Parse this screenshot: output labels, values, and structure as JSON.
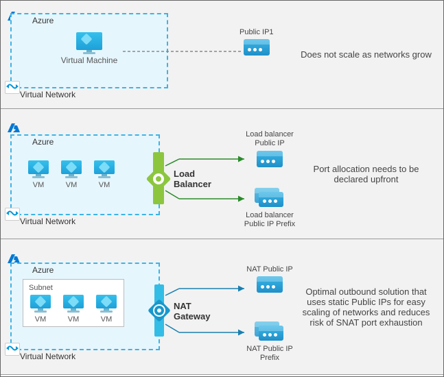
{
  "azure_label": "Azure",
  "vnet_label": "Virtual Network",
  "row1": {
    "vm_label": "Virtual Machine",
    "pip_label": "Public IP1",
    "desc": "Does not scale as networks grow"
  },
  "row2": {
    "vm_label": "VM",
    "svc_label": "Load Balancer",
    "pip_label": "Load balancer Public IP",
    "prefix_label": "Load balancer Public IP Prefix",
    "desc": "Port allocation needs to be declared upfront"
  },
  "row3": {
    "subnet_label": "Subnet",
    "vm_label": "VM",
    "svc_label": "NAT Gateway",
    "pip_label": "NAT Public IP",
    "prefix_label": "NAT Public IP Prefix",
    "desc": "Optimal outbound solution that uses static Public IPs for easy scaling of networks and reduces risk of SNAT port exhaustion"
  }
}
